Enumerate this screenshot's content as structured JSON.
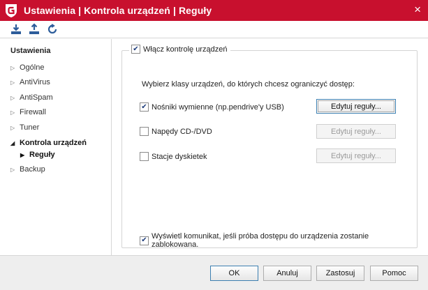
{
  "window": {
    "title": "Ustawienia | Kontrola urządzeń | Reguły",
    "close_symbol": "×",
    "accent": "#c8102e"
  },
  "toolbar": {
    "icons": [
      "import-icon",
      "export-icon",
      "restore-defaults-icon"
    ]
  },
  "sidebar": {
    "heading": "Ustawienia",
    "items": [
      {
        "label": "Ogólne"
      },
      {
        "label": "AntiVirus"
      },
      {
        "label": "AntiSpam"
      },
      {
        "label": "Firewall"
      },
      {
        "label": "Tuner"
      },
      {
        "label": "Kontrola urządzeń",
        "active": true
      },
      {
        "label": "Reguły",
        "sub": true
      },
      {
        "label": "Backup"
      }
    ]
  },
  "main": {
    "enable_label": "Włącz kontrolę urządzeń",
    "enable_checked": true,
    "intro": "Wybierz klasy urządzeń, do których chcesz ograniczyć dostęp:",
    "devices": [
      {
        "label": "Nośniki wymienne (np.pendrive'y USB)",
        "checked": true,
        "button": "Edytuj reguły...",
        "button_enabled": true
      },
      {
        "label": "Napędy CD-/DVD",
        "checked": false,
        "button": "Edytuj reguły...",
        "button_enabled": false
      },
      {
        "label": "Stacje dyskietek",
        "checked": false,
        "button": "Edytuj reguły...",
        "button_enabled": false
      }
    ],
    "notify_label": "Wyświetl komunikat, jeśli próba dostępu do urządzenia zostanie zablokowana.",
    "notify_checked": true
  },
  "footer": {
    "ok": "OK",
    "cancel": "Anuluj",
    "apply": "Zastosuj",
    "help": "Pomoc"
  }
}
